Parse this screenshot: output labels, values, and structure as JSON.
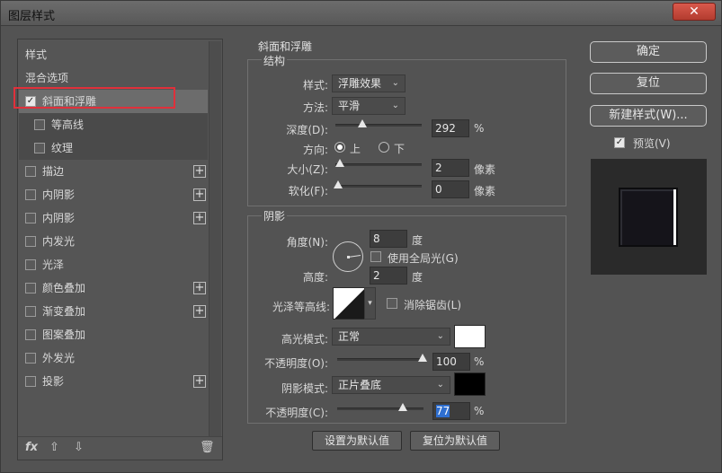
{
  "window": {
    "title": "图层样式",
    "close_label": "✕"
  },
  "left": {
    "items": [
      {
        "label": "样式"
      },
      {
        "label": "混合选项"
      },
      {
        "label": "斜面和浮雕",
        "checked": true
      },
      {
        "label": "等高线",
        "checked": false
      },
      {
        "label": "纹理",
        "checked": false
      },
      {
        "label": "描边",
        "checked": false
      },
      {
        "label": "内阴影",
        "checked": false
      },
      {
        "label": "内阴影",
        "checked": false
      },
      {
        "label": "内发光",
        "checked": false
      },
      {
        "label": "光泽",
        "checked": false
      },
      {
        "label": "颜色叠加",
        "checked": false
      },
      {
        "label": "渐变叠加",
        "checked": false
      },
      {
        "label": "图案叠加",
        "checked": false
      },
      {
        "label": "外发光",
        "checked": false
      },
      {
        "label": "投影",
        "checked": false
      }
    ],
    "footer": {
      "fx": "fx",
      "up": "⇧",
      "down": "⇩",
      "trash": "🗑"
    }
  },
  "bevel": {
    "title": "斜面和浮雕",
    "structure_title": "结构",
    "style_label": "样式:",
    "style_value": "浮雕效果",
    "method_label": "方法:",
    "method_value": "平滑",
    "depth_label": "深度(D):",
    "depth_value": "292",
    "depth_unit": "%",
    "direction_label": "方向:",
    "dir_up": "上",
    "dir_down": "下",
    "size_label": "大小(Z):",
    "size_value": "2",
    "size_unit": "像素",
    "soften_label": "软化(F):",
    "soften_value": "0",
    "soften_unit": "像素"
  },
  "shading": {
    "title": "阴影",
    "angle_label": "角度(N):",
    "angle_value": "8",
    "angle_unit": "度",
    "global_light_label": "使用全局光(G)",
    "altitude_label": "高度:",
    "altitude_value": "2",
    "altitude_unit": "度",
    "gloss_label": "光泽等高线:",
    "antialias_label": "消除锯齿(L)",
    "highlight_mode_label": "高光模式:",
    "highlight_mode_value": "正常",
    "highlight_color": "#ffffff",
    "highlight_opacity_label": "不透明度(O):",
    "highlight_opacity_value": "100",
    "highlight_opacity_unit": "%",
    "shadow_mode_label": "阴影模式:",
    "shadow_mode_value": "正片叠底",
    "shadow_color": "#000000",
    "shadow_opacity_label": "不透明度(C):",
    "shadow_opacity_value": "77",
    "shadow_opacity_unit": "%"
  },
  "buttons": {
    "make_default": "设置为默认值",
    "reset_default": "复位为默认值",
    "ok": "确定",
    "reset": "复位",
    "new_style": "新建样式(W)...",
    "preview_label": "预览(V)"
  }
}
